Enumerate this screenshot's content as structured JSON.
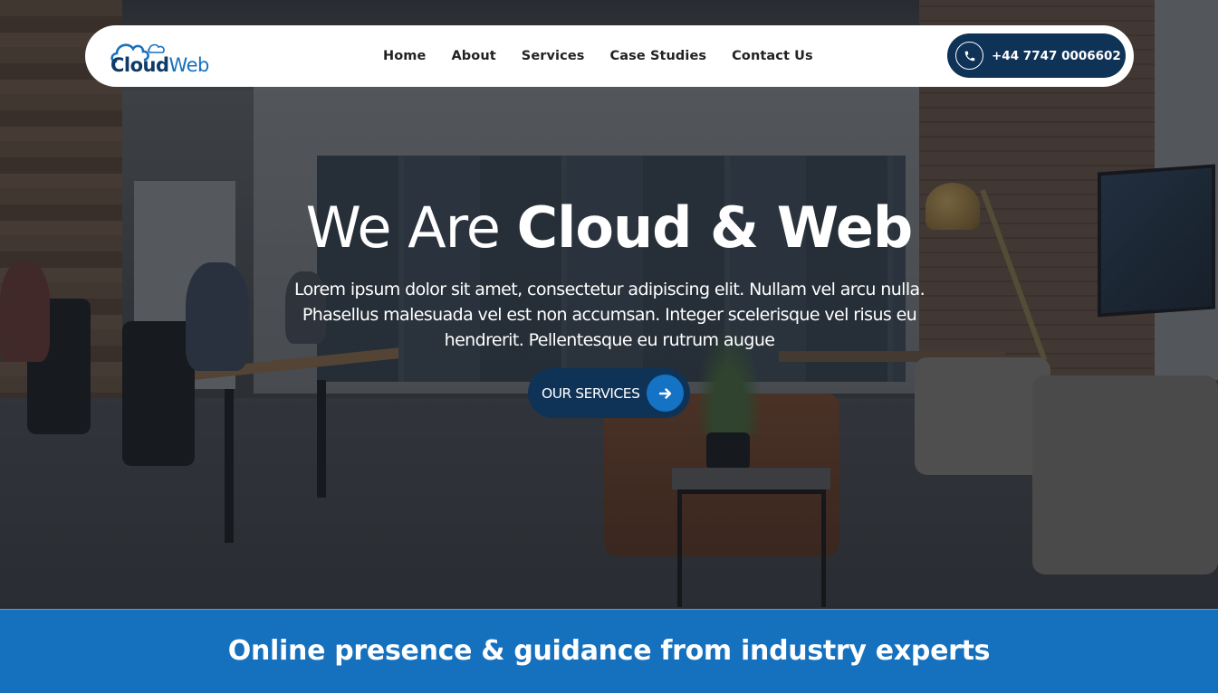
{
  "brand": {
    "logo_part1": "Cloud",
    "logo_part2": "Web",
    "primary_color": "#0f3257",
    "accent_color": "#1570bd"
  },
  "nav": {
    "links": [
      {
        "label": "Home"
      },
      {
        "label": "About"
      },
      {
        "label": "Services"
      },
      {
        "label": "Case Studies"
      },
      {
        "label": "Contact Us"
      }
    ],
    "phone": {
      "icon": "phone-icon",
      "number": "+44 7747 0006602"
    }
  },
  "hero": {
    "headline_light": "We Are ",
    "headline_bold": "Cloud & Web",
    "subtext": "Lorem ipsum dolor sit amet, consectetur adipiscing elit. Nullam vel arcu nulla. Phasellus malesuada vel est non accumsan. Integer scelerisque vel risus eu hendrerit. Pellentesque eu rutrum augue",
    "cta_label": "OUR SERVICES",
    "cta_icon": "arrow-right-icon"
  },
  "banner": {
    "text": "Online presence & guidance from industry experts"
  }
}
